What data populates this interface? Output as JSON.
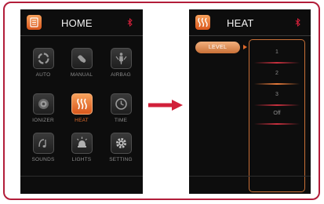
{
  "home_screen": {
    "title": "HOME",
    "header_icon": "list-icon",
    "status_icon": "bluetooth-icon",
    "tiles": [
      {
        "label": "AUTO",
        "icon": "auto-cycle-icon",
        "active": false
      },
      {
        "label": "MANUAL",
        "icon": "hand-icon",
        "active": false
      },
      {
        "label": "AIRBAG",
        "icon": "body-airbag-icon",
        "active": false
      },
      {
        "label": "IONIZER",
        "icon": "ionizer-icon",
        "active": false
      },
      {
        "label": "HEAT",
        "icon": "heat-waves-icon",
        "active": true
      },
      {
        "label": "TIME",
        "icon": "clock-icon",
        "active": false
      },
      {
        "label": "SOUNDS",
        "icon": "music-note-icon",
        "active": false
      },
      {
        "label": "LIGHTS",
        "icon": "lamp-icon",
        "active": false
      },
      {
        "label": "SETTING",
        "icon": "gear-icon",
        "active": false
      }
    ]
  },
  "heat_screen": {
    "title": "HEAT",
    "header_icon": "heat-waves-icon",
    "status_icon": "bluetooth-icon",
    "level_button": "LEVEL",
    "options": [
      "1",
      "2",
      "3",
      "Off"
    ]
  },
  "transition_arrow": "right-arrow-icon",
  "colors": {
    "frame_border": "#b21d3a",
    "screen_bg": "#0d0d0d",
    "accent_orange": "#e06a2b",
    "arrow_red": "#d1203a"
  }
}
